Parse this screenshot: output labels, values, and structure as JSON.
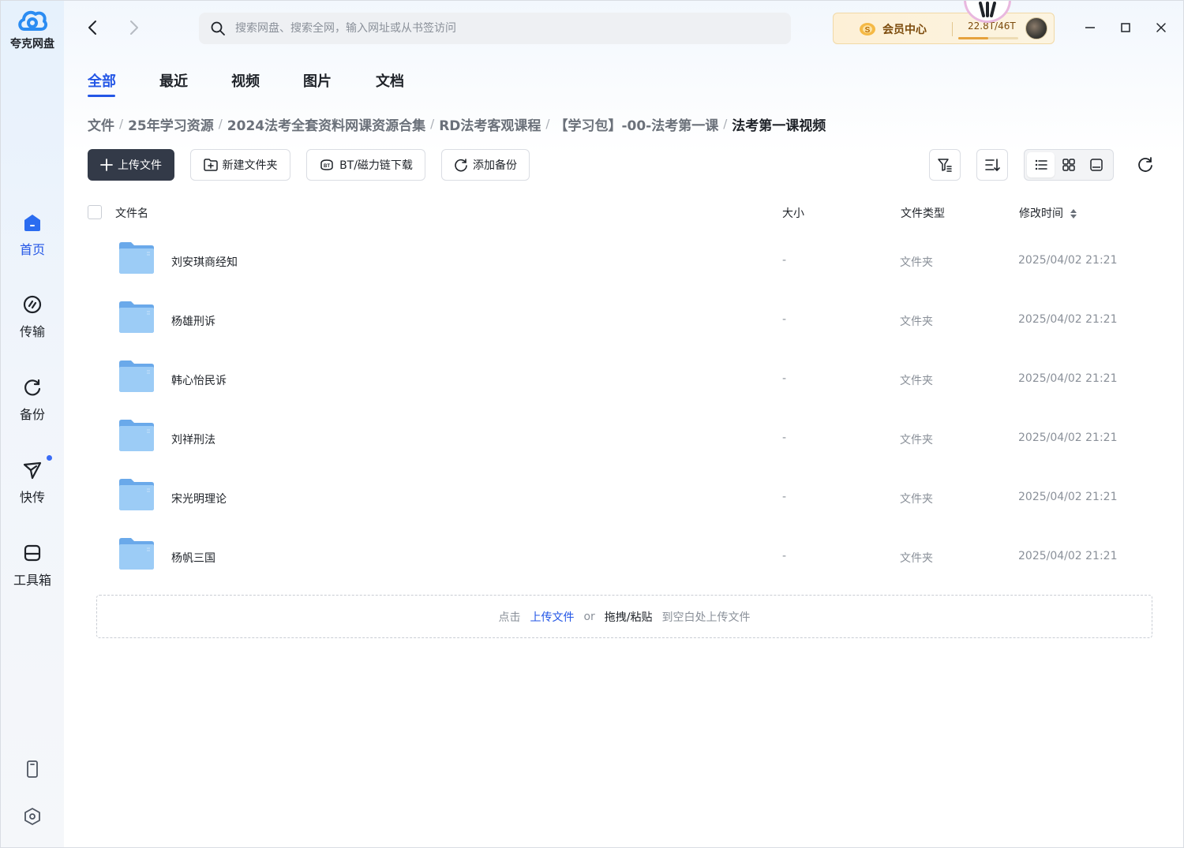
{
  "app": {
    "name": "夸克网盘"
  },
  "sidebar": {
    "items": [
      {
        "label": "首页",
        "icon": "home-icon",
        "active": true
      },
      {
        "label": "传输",
        "icon": "transfer-icon"
      },
      {
        "label": "备份",
        "icon": "backup-icon"
      },
      {
        "label": "快传",
        "icon": "send-icon",
        "has_dot": true
      },
      {
        "label": "工具箱",
        "icon": "toolbox-icon"
      }
    ],
    "bottom": [
      {
        "icon": "phone-icon"
      },
      {
        "icon": "settings-icon"
      }
    ]
  },
  "header": {
    "search": {
      "placeholder": "搜索网盘、搜索全网，输入网址或从书签访问"
    },
    "vip": {
      "label": "会员中心"
    },
    "storage": {
      "used": "22.8T",
      "total": "46T",
      "label": "22.8T/46T",
      "fraction": 0.5
    }
  },
  "tabs": [
    {
      "label": "全部",
      "active": true
    },
    {
      "label": "最近"
    },
    {
      "label": "视频"
    },
    {
      "label": "图片"
    },
    {
      "label": "文档"
    }
  ],
  "breadcrumb": [
    "文件",
    "25年学习资源",
    "2024法考全套资料网课资源合集",
    "RD法考客观课程",
    "【学习包】-00-法考第一课",
    "法考第一课视频"
  ],
  "toolbar": {
    "upload": "上传文件",
    "new_folder": "新建文件夹",
    "bt_download": "BT/磁力链下载",
    "add_backup": "添加备份"
  },
  "table": {
    "columns": {
      "name": "文件名",
      "size": "大小",
      "type": "文件类型",
      "modified": "修改时间"
    },
    "rows": [
      {
        "name": "刘安琪商经知",
        "size": "-",
        "type": "文件夹",
        "modified": "2025/04/02 21:21"
      },
      {
        "name": "杨雄刑诉",
        "size": "-",
        "type": "文件夹",
        "modified": "2025/04/02 21:21"
      },
      {
        "name": "韩心怡民诉",
        "size": "-",
        "type": "文件夹",
        "modified": "2025/04/02 21:21"
      },
      {
        "name": "刘祥刑法",
        "size": "-",
        "type": "文件夹",
        "modified": "2025/04/02 21:21"
      },
      {
        "name": "宋光明理论",
        "size": "-",
        "type": "文件夹",
        "modified": "2025/04/02 21:21"
      },
      {
        "name": "杨帆三国",
        "size": "-",
        "type": "文件夹",
        "modified": "2025/04/02 21:21"
      }
    ]
  },
  "dropzone": {
    "prefix": "点击",
    "upload_link": "上传文件",
    "or": "or",
    "drag": "拖拽/粘贴",
    "suffix": "到空白处上传文件"
  },
  "colors": {
    "accent": "#2356e6",
    "primary_button": "#333a48",
    "folder": "#7fb8ef"
  }
}
